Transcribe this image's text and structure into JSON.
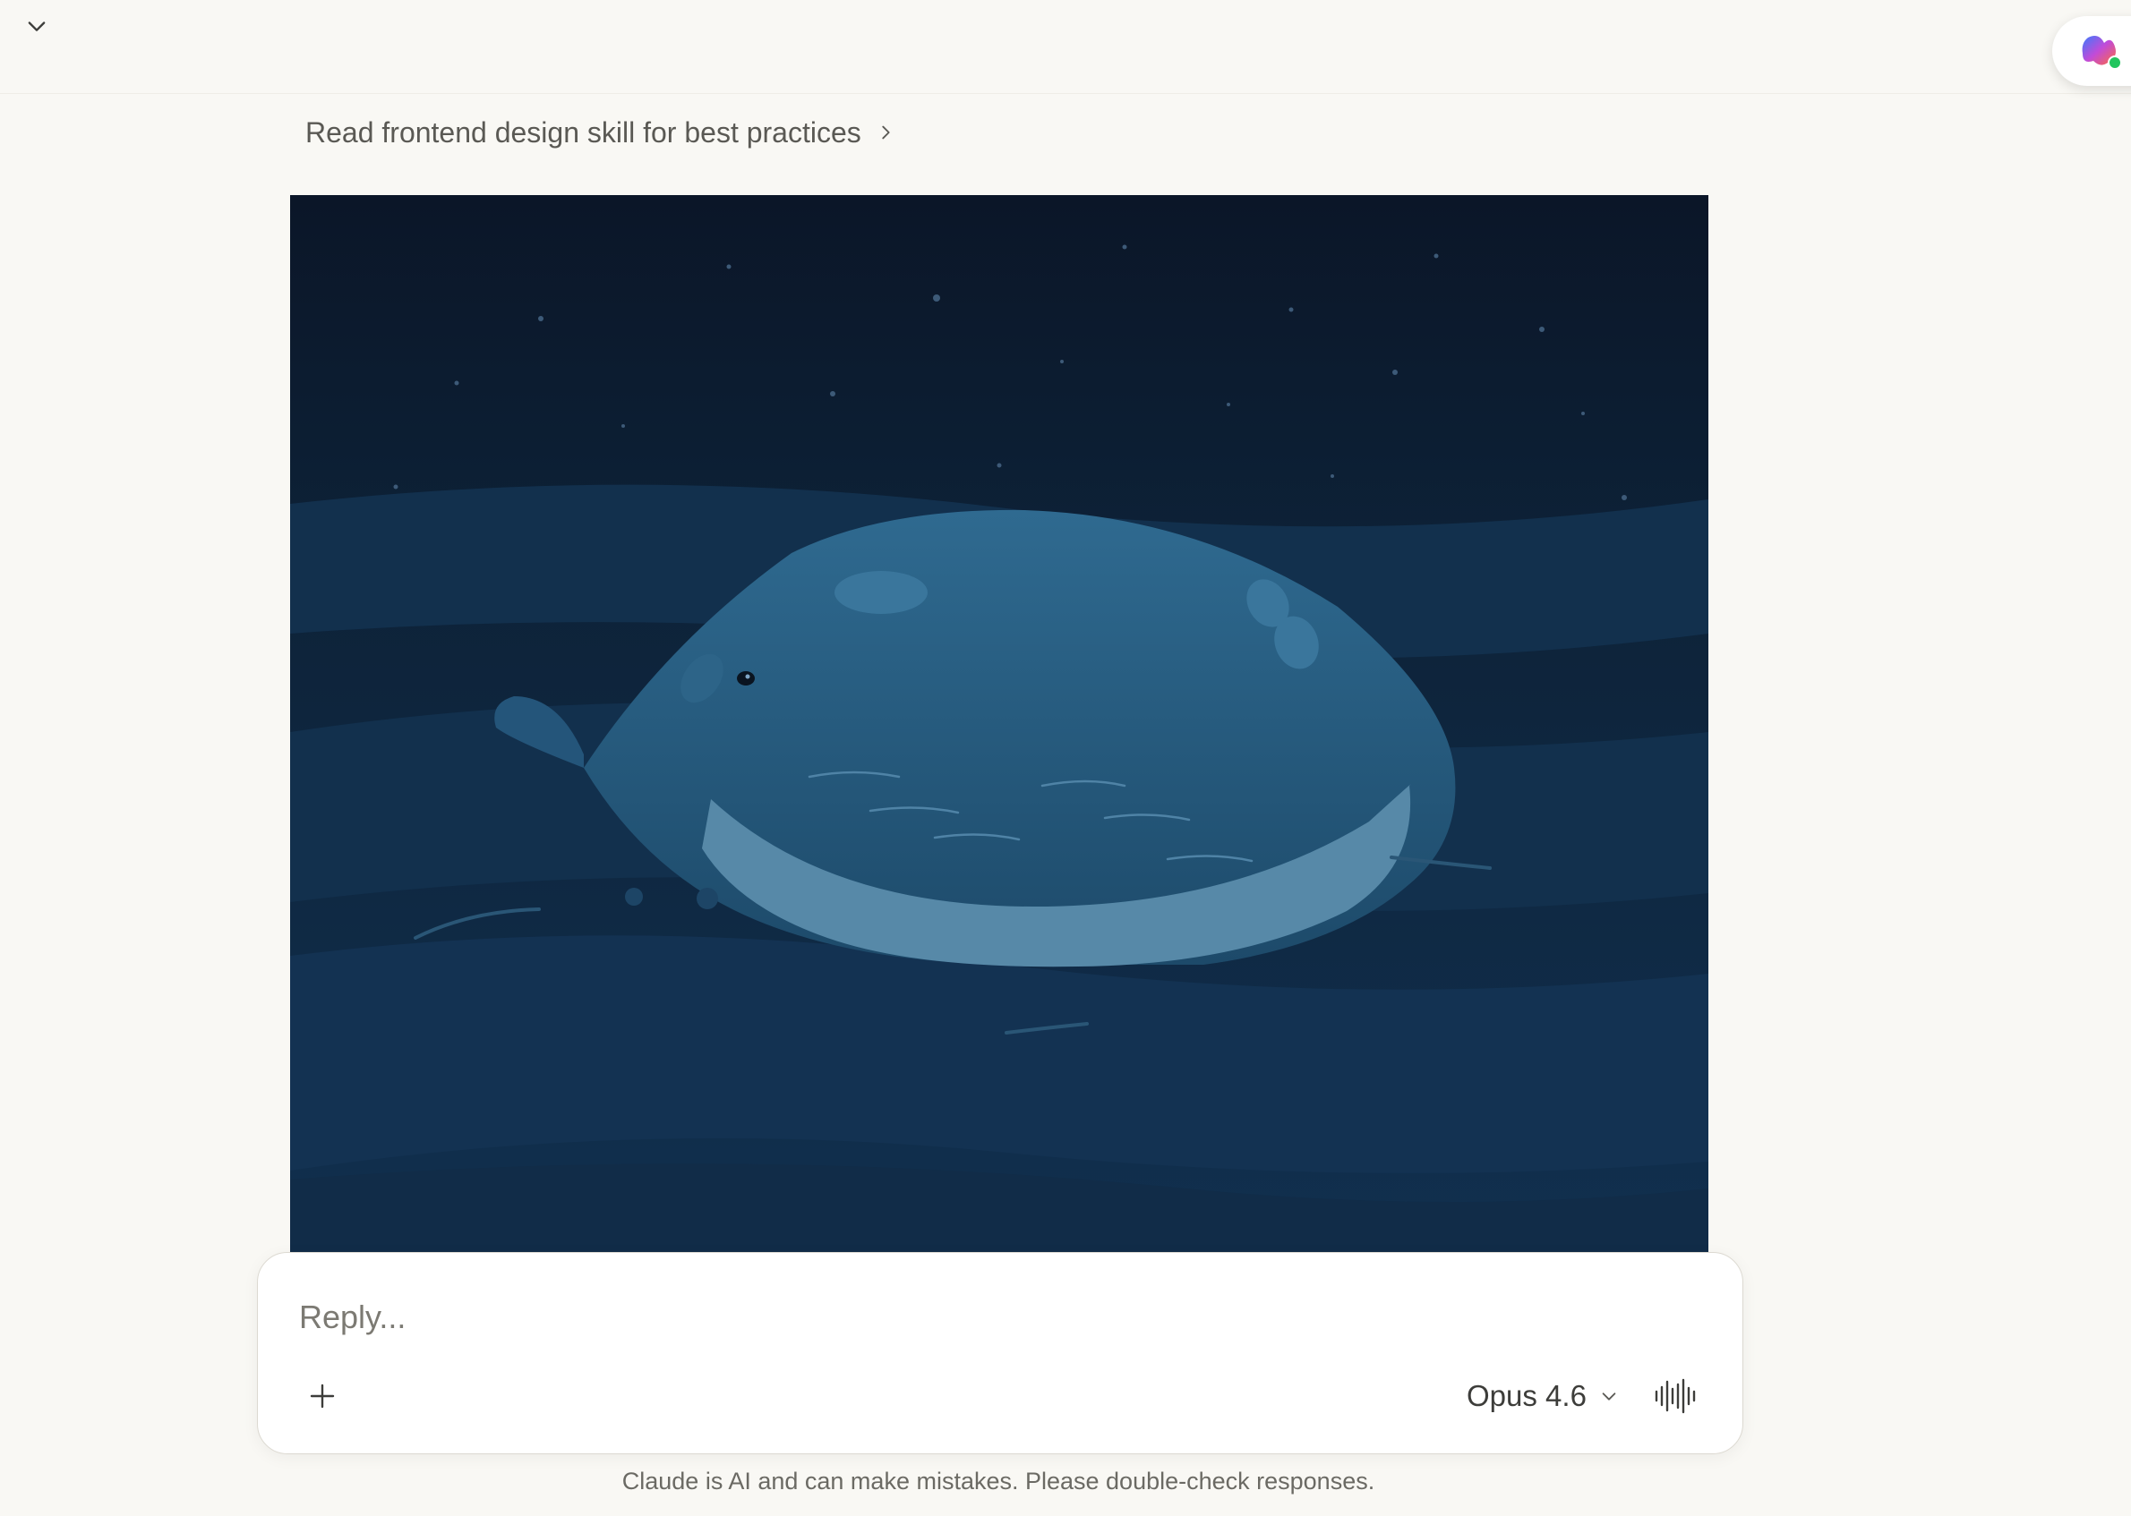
{
  "topbar": {
    "collapse_icon": "chevron-down-icon",
    "app_badge_icon": "app-logo-icon"
  },
  "step": {
    "label": "Read frontend design skill for best practices",
    "icon": "chevron-right-icon"
  },
  "artifact": {
    "description_icon": "whale-illustration",
    "colors": {
      "sky_top": "#0b1628",
      "sky_bottom": "#0f2a45",
      "water": "#133050",
      "whale_body": "#285d80",
      "whale_belly": "#5789a8"
    }
  },
  "composer": {
    "placeholder": "Reply...",
    "value": "",
    "attach_icon": "plus-icon",
    "model_label": "Opus 4.6",
    "model_icon": "chevron-down-icon",
    "voice_icon": "voice-waveform-icon"
  },
  "footer": {
    "disclaimer": "Claude is AI and can make mistakes. Please double-check responses."
  }
}
